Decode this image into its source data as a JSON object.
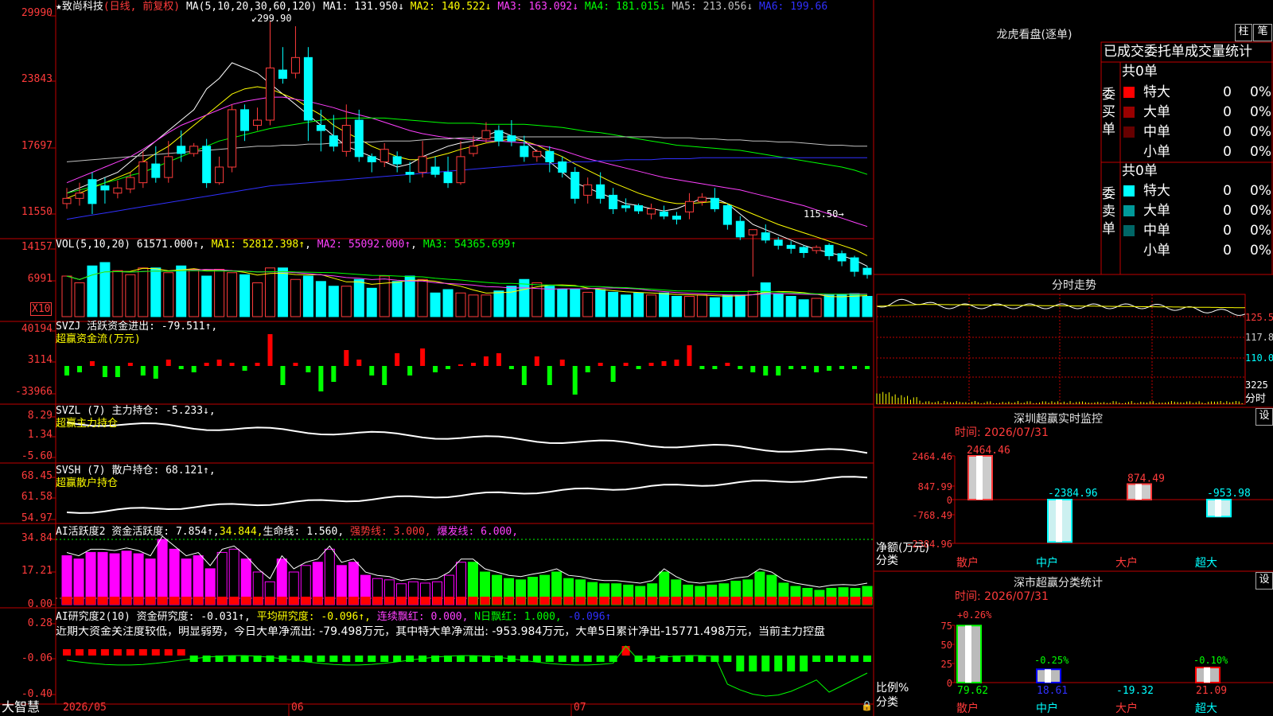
{
  "kline": {
    "title": "★致尚科技",
    "subtitle": "(日线, 前复权)",
    "ma_params": "MA(5,10,20,30,60,120)",
    "ma_values": [
      {
        "label": "MA1: 131.950↓",
        "color": "#ffffff"
      },
      {
        "label": "MA2: 140.522↓",
        "color": "#ffff00"
      },
      {
        "label": "MA3: 163.092↓",
        "color": "#ff40ff"
      },
      {
        "label": "MA4: 181.015↓",
        "color": "#00ff00"
      },
      {
        "label": "MA5: 213.056↓",
        "color": "#c0c0c0"
      },
      {
        "label": "MA6: 199.66",
        "color": "#3030ff"
      }
    ],
    "high_label": "299.90",
    "low_label": "115.50",
    "ymax": 299.9,
    "ymin": 110,
    "yticks": [
      "29990",
      "23843",
      "17697",
      "11550"
    ],
    "candles": [
      [
        120,
        125,
        115,
        135
      ],
      [
        125,
        130,
        118,
        140
      ],
      [
        143,
        120,
        110,
        150
      ],
      [
        137,
        133,
        120,
        145
      ],
      [
        130,
        135,
        125,
        142
      ],
      [
        134,
        145,
        130,
        150
      ],
      [
        140,
        160,
        135,
        170
      ],
      [
        158,
        145,
        140,
        175
      ],
      [
        145,
        165,
        140,
        180
      ],
      [
        175,
        168,
        160,
        190
      ],
      [
        168,
        175,
        165,
        178
      ],
      [
        175,
        140,
        135,
        182
      ],
      [
        140,
        155,
        138,
        165
      ],
      [
        155,
        210,
        150,
        215
      ],
      [
        210,
        190,
        180,
        215
      ],
      [
        195,
        200,
        190,
        212
      ],
      [
        200,
        250,
        195,
        295
      ],
      [
        248,
        240,
        235,
        270
      ],
      [
        245,
        260,
        240,
        290
      ],
      [
        260,
        200,
        180,
        270
      ],
      [
        195,
        190,
        170,
        210
      ],
      [
        185,
        175,
        170,
        205
      ],
      [
        170,
        195,
        165,
        215
      ],
      [
        200,
        165,
        160,
        210
      ],
      [
        165,
        160,
        150,
        168
      ],
      [
        160,
        172,
        155,
        178
      ],
      [
        165,
        158,
        150,
        170
      ],
      [
        150,
        148,
        140,
        160
      ],
      [
        150,
        165,
        145,
        180
      ],
      [
        155,
        148,
        145,
        165
      ],
      [
        150,
        140,
        135,
        165
      ],
      [
        140,
        165,
        138,
        180
      ],
      [
        168,
        175,
        165,
        185
      ],
      [
        182,
        190,
        178,
        198
      ],
      [
        190,
        180,
        175,
        195
      ],
      [
        185,
        180,
        175,
        200
      ],
      [
        175,
        165,
        160,
        185
      ],
      [
        165,
        170,
        160,
        172
      ],
      [
        170,
        160,
        150,
        175
      ],
      [
        160,
        150,
        145,
        165
      ],
      [
        150,
        125,
        120,
        155
      ],
      [
        128,
        138,
        120,
        145
      ],
      [
        138,
        125,
        120,
        150
      ],
      [
        128,
        115,
        110,
        135
      ],
      [
        118,
        116,
        112,
        125
      ],
      [
        118,
        113,
        110,
        120
      ],
      [
        110,
        115,
        105,
        120
      ],
      [
        112,
        108,
        105,
        118
      ],
      [
        108,
        105,
        100,
        112
      ],
      [
        112,
        122,
        105,
        130
      ],
      [
        122,
        126,
        118,
        130
      ],
      [
        125,
        115,
        112,
        135
      ],
      [
        118,
        100,
        95,
        120
      ],
      [
        103,
        88,
        85,
        108
      ],
      [
        90,
        95,
        50,
        95
      ],
      [
        92,
        85,
        82,
        100
      ],
      [
        85,
        80,
        76,
        88
      ],
      [
        80,
        77,
        72,
        84
      ],
      [
        78,
        73,
        68,
        80
      ],
      [
        75,
        78,
        72,
        80
      ],
      [
        80,
        70,
        66,
        82
      ],
      [
        72,
        65,
        60,
        75
      ],
      [
        68,
        55,
        50,
        70
      ],
      [
        58,
        52,
        48,
        60
      ]
    ],
    "ma_lines": {
      "ma1": [
        130,
        135,
        140,
        145,
        150,
        160,
        170,
        180,
        190,
        200,
        210,
        230,
        240,
        255,
        250,
        245,
        235,
        225,
        215,
        205,
        195,
        185,
        175,
        170,
        165,
        160,
        155,
        158,
        165,
        170,
        175,
        178,
        180,
        185,
        190,
        185,
        180,
        170,
        160,
        150,
        140,
        135,
        130,
        125,
        120,
        118,
        115,
        113,
        115,
        120,
        125,
        125,
        120,
        110,
        100,
        95,
        90,
        85,
        80,
        76,
        73,
        70,
        66,
        60
      ],
      "ma2": [
        125,
        130,
        135,
        140,
        145,
        150,
        160,
        168,
        175,
        185,
        195,
        205,
        215,
        225,
        230,
        232,
        230,
        225,
        220,
        212,
        205,
        195,
        188,
        182,
        175,
        170,
        165,
        162,
        162,
        165,
        168,
        172,
        175,
        178,
        180,
        182,
        180,
        176,
        170,
        165,
        158,
        152,
        146,
        140,
        135,
        130,
        126,
        122,
        120,
        120,
        121,
        122,
        120,
        115,
        110,
        105,
        100,
        96,
        92,
        88,
        84,
        80,
        76,
        70
      ],
      "ma3": [
        140,
        145,
        150,
        155,
        160,
        165,
        172,
        180,
        188,
        195,
        200,
        205,
        210,
        215,
        218,
        220,
        222,
        222,
        220,
        218,
        215,
        212,
        208,
        205,
        202,
        198,
        194,
        190,
        187,
        185,
        183,
        182,
        181,
        180,
        180,
        179,
        178,
        176,
        174,
        171,
        167,
        163,
        160,
        157,
        154,
        151,
        148,
        145,
        143,
        141,
        139,
        137,
        135,
        133,
        130,
        127,
        124,
        121,
        118,
        114,
        110,
        106,
        102,
        98
      ],
      "ma4": [
        130,
        133,
        136,
        140,
        143,
        147,
        150,
        155,
        160,
        165,
        170,
        175,
        180,
        183,
        186,
        189,
        192,
        194,
        196,
        198,
        200,
        201,
        202,
        202,
        202,
        202,
        201,
        200,
        199,
        198,
        197,
        197,
        197,
        196,
        196,
        196,
        196,
        195,
        194,
        193,
        191,
        189,
        188,
        186,
        184,
        182,
        180,
        178,
        176,
        175,
        174,
        173,
        172,
        171,
        169,
        167,
        165,
        163,
        161,
        159,
        157,
        155,
        152,
        148
      ],
      "ma5": [
        160,
        161,
        162,
        163,
        164,
        165,
        166,
        167,
        168,
        169,
        170,
        171,
        172,
        173,
        174,
        175,
        175,
        176,
        176,
        177,
        177,
        178,
        178,
        179,
        179,
        180,
        180,
        180,
        181,
        182,
        182,
        183,
        183,
        183,
        184,
        184,
        184,
        184,
        184,
        184,
        184,
        184,
        184,
        184,
        184,
        184,
        184,
        183,
        183,
        183,
        182,
        182,
        181,
        181,
        180,
        180,
        179,
        179,
        178,
        177,
        176,
        176,
        175,
        175
      ],
      "ma6": [
        105,
        107,
        109,
        111,
        113,
        115,
        117,
        119,
        121,
        123,
        125,
        127,
        129,
        131,
        133,
        135,
        137,
        138,
        139,
        140,
        141,
        142,
        143,
        144,
        145,
        146,
        147,
        148,
        149,
        150,
        151,
        152,
        153,
        154,
        155,
        156,
        157,
        158,
        158,
        159,
        160,
        160,
        161,
        161,
        162,
        162,
        162,
        163,
        163,
        163,
        164,
        164,
        164,
        164,
        164,
        164,
        164,
        164,
        164,
        164,
        164,
        164,
        164,
        164
      ]
    }
  },
  "vol": {
    "params": "VOL(5,10,20)",
    "value": "61571.000↑",
    "ma1": "MA1: 52812.398↑",
    "ma2": "MA2: 55092.000↑",
    "ma3": "MA3: 54365.699↑",
    "yticks": [
      "14157",
      "6991"
    ],
    "unit": "X10",
    "bars": [
      0.6,
      0.5,
      0.75,
      0.8,
      0.68,
      0.62,
      0.72,
      0.72,
      0.65,
      0.75,
      0.7,
      0.6,
      0.7,
      0.65,
      0.62,
      0.5,
      0.72,
      0.72,
      0.55,
      0.6,
      0.52,
      0.45,
      0.45,
      0.55,
      0.42,
      0.6,
      0.52,
      0.6,
      0.55,
      0.35,
      0.4,
      0.35,
      0.32,
      0.32,
      0.38,
      0.45,
      0.55,
      0.5,
      0.45,
      0.4,
      0.4,
      0.36,
      0.4,
      0.36,
      0.32,
      0.35,
      0.32,
      0.35,
      0.3,
      0.3,
      0.32,
      0.28,
      0.32,
      0.32,
      0.38,
      0.5,
      0.34,
      0.3,
      0.25,
      0.27,
      0.32,
      0.33,
      0.34,
      0.3
    ]
  },
  "svzj": {
    "title": "SVZJ  活跃资金进出: -79.511↑,",
    "subtitle": "超赢资金流(万元)",
    "yticks": [
      "40194",
      "3114",
      "-33966"
    ],
    "bars": [
      -0.3,
      -0.2,
      0.15,
      -0.35,
      -0.35,
      0.1,
      -0.3,
      -0.4,
      0.2,
      -0.1,
      -0.2,
      0.1,
      0.2,
      0.1,
      -0.15,
      0.1,
      1.0,
      -0.6,
      0.1,
      -0.2,
      -0.8,
      -0.5,
      0.5,
      0.2,
      -0.3,
      -0.6,
      0.4,
      -0.3,
      0.55,
      -0.2,
      -0.1,
      0.05,
      0.1,
      0.3,
      0.4,
      -0.1,
      -0.6,
      0.3,
      -0.6,
      0.2,
      -0.9,
      -0.2,
      0.1,
      -0.5,
      0.1,
      -0.1,
      0.1,
      0.15,
      0.2,
      0.65,
      -0.1,
      -0.1,
      0.1,
      -0.1,
      -0.2,
      -0.3,
      -0.3,
      -0.1,
      -0.1,
      -0.2,
      -0.15,
      -0.1,
      -0.1,
      -0.1
    ]
  },
  "svzl": {
    "title": "SVZL (7) 主力持仓: -5.233↓,",
    "subtitle": "超赢主力持仓",
    "yticks": [
      "8.29",
      "1.34",
      "-5.60"
    ]
  },
  "svsh": {
    "title": "SVSH (7) 散户持仓: 68.121↑,",
    "subtitle": "超赢散户持仓",
    "yticks": [
      "68.45",
      "61.58",
      "54.97"
    ]
  },
  "ai1": {
    "title": "AI活跃度2 资金活跃度: 7.854↑,",
    "v2": "34.844,",
    "life": "生命线: 1.560,",
    "strong": "强势线: 3.000,",
    "burst": "爆发线: 6.000,",
    "yticks": [
      "34.84",
      "17.21",
      "0.00"
    ],
    "bars": [
      0.75,
      0.7,
      0.8,
      0.8,
      0.78,
      0.82,
      0.78,
      0.7,
      1.0,
      0.85,
      0.7,
      0.75,
      0.55,
      0.8,
      0.85,
      0.7,
      0.5,
      0.35,
      0.7,
      0.5,
      0.6,
      0.65,
      0.85,
      0.6,
      0.65,
      0.45,
      0.4,
      0.38,
      0.32,
      0.35,
      0.33,
      0.35,
      0.45,
      0.65,
      0.65,
      0.5,
      0.45,
      0.4,
      0.38,
      0.42,
      0.45,
      0.5,
      0.4,
      0.38,
      0.34,
      0.32,
      0.32,
      0.3,
      0.28,
      0.32,
      0.5,
      0.38,
      0.3,
      0.28,
      0.3,
      0.32,
      0.36,
      0.38,
      0.5,
      0.45,
      0.33,
      0.28,
      0.25,
      0.22,
      0.25,
      0.26,
      0.25,
      0.28
    ]
  },
  "ai2": {
    "title": "AI研究度2(10) 资金研究度: -0.031↑,",
    "avg": "平均研究度: -0.096↑,",
    "red": "连续飘红: 0.000,",
    "nred": "N日飘红: 1.000,",
    "last": "-0.096↑",
    "comment": "近期大资金关注度较低，明显弱势，今日大单净流出: -79.498万元，其中特大单净流出: -953.984万元，大单5日累计净出-15771.498万元，当前主力控盘",
    "yticks": [
      "0.28",
      "-0.06",
      "-0.40"
    ]
  },
  "xaxis": {
    "labels": [
      "2026/05",
      "06",
      "07"
    ],
    "brand": "大智慧"
  },
  "sidebar": {
    "dragon_title": "龙虎看盘(逐单)",
    "btn_zhu": "柱",
    "btn_bi": "笔",
    "table_title": "已成交委托单成交量统计",
    "buy_label": "委买单",
    "sell_label": "委卖单",
    "buy_count": "共0单",
    "sell_count": "共0单",
    "buy_rows": [
      {
        "name": "特大",
        "value": "0",
        "pct": "0%",
        "color": "#ff0000"
      },
      {
        "name": "大单",
        "value": "0",
        "pct": "0%",
        "color": "#990000"
      },
      {
        "name": "中单",
        "value": "0",
        "pct": "0%",
        "color": "#660000"
      },
      {
        "name": "小单",
        "value": "0",
        "pct": "0%",
        "color": "#000000"
      }
    ],
    "sell_rows": [
      {
        "name": "特大",
        "value": "0",
        "pct": "0%",
        "color": "#00ffff"
      },
      {
        "name": "大单",
        "value": "0",
        "pct": "0%",
        "color": "#009999"
      },
      {
        "name": "中单",
        "value": "0",
        "pct": "0%",
        "color": "#006666"
      },
      {
        "name": "小单",
        "value": "0",
        "pct": "0%",
        "color": "#000000"
      }
    ],
    "fenshi_title": "分时走势",
    "fenshi_prices": [
      "125.5",
      "117.8",
      "110.0"
    ],
    "fenshi_vol": "3225",
    "fenshi_unit": "分时",
    "sz_title": "深圳超赢实时监控",
    "sz_btn": "设",
    "sz_time": "时间: 2026/07/31",
    "sz_yticks": [
      "2464.46",
      "847.99",
      "0",
      "-768.49",
      "-2384.96"
    ],
    "sz_values": [
      "2464.46",
      "-2384.96",
      "874.49",
      "-953.98"
    ],
    "sz_unit": "净额(万元)",
    "sz_cat": "分类",
    "sz_cats": [
      "散户",
      "中户",
      "大户",
      "超大"
    ],
    "sh_title": "深市超赢分类统计",
    "sh_btn": "设",
    "sh_time": "时间: 2026/07/31",
    "sh_yticks": [
      "75",
      "50",
      "25",
      "0"
    ],
    "sh_top": [
      "+0.26%",
      "-0.25%",
      "-0.10%"
    ],
    "sh_values": [
      "79.62",
      "18.61",
      "-19.32",
      "21.09"
    ],
    "sh_unit": "比例%",
    "sh_cat": "分类",
    "sh_cats": [
      "散户",
      "中户",
      "大户",
      "超大"
    ]
  }
}
